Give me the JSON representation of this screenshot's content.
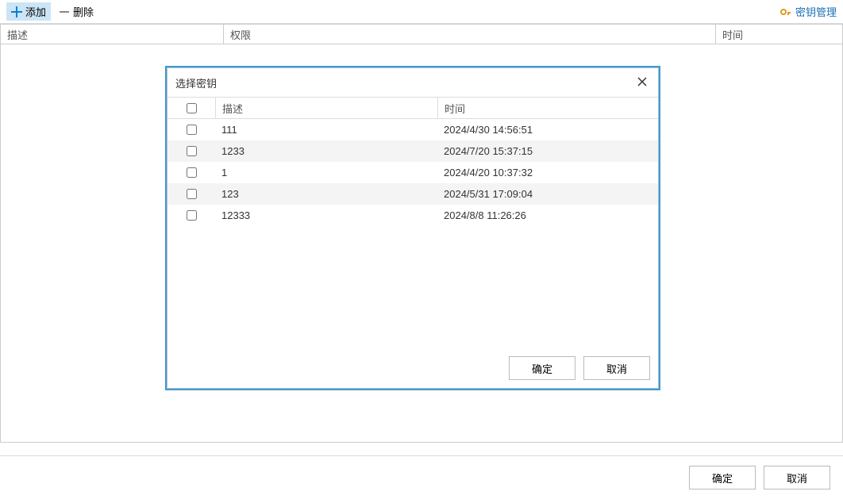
{
  "toolbar": {
    "add_label": "添加",
    "delete_label": "删除",
    "key_mgmt_label": "密钥管理"
  },
  "grid": {
    "cols": {
      "desc": "描述",
      "perm": "权限",
      "time": "时间"
    }
  },
  "dialog": {
    "title": "选择密钥",
    "cols": {
      "desc": "描述",
      "time": "时间"
    },
    "rows": [
      {
        "desc": "111",
        "time": "2024/4/30 14:56:51"
      },
      {
        "desc": "1233",
        "time": "2024/7/20 15:37:15"
      },
      {
        "desc": "1",
        "time": "2024/4/20 10:37:32"
      },
      {
        "desc": "123",
        "time": "2024/5/31 17:09:04"
      },
      {
        "desc": "12333",
        "time": "2024/8/8 11:26:26"
      }
    ],
    "ok_label": "确定",
    "cancel_label": "取消"
  },
  "footer": {
    "ok_label": "确定",
    "cancel_label": "取消"
  }
}
